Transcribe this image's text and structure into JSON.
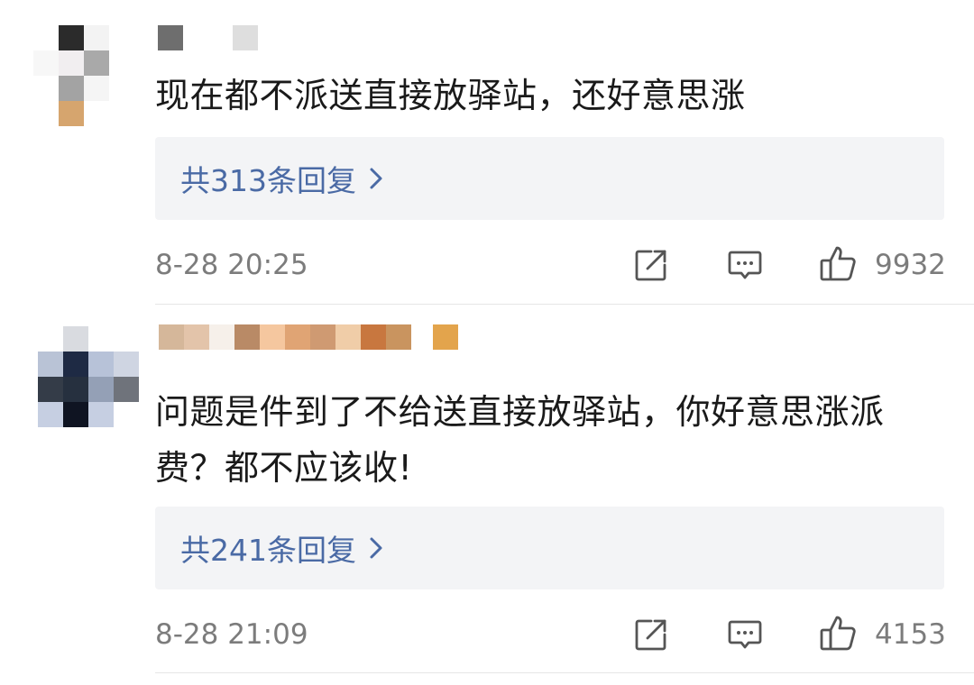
{
  "comments": [
    {
      "text": "现在都不派送直接放驿站，还好意思涨",
      "replies_label": "共313条回复",
      "time": "8-28 20:25",
      "likes": "9932"
    },
    {
      "text": "问题是件到了不给送直接放驿站，你好意思涨派费？都不应该收!",
      "replies_label": "共241条回复",
      "time": "8-28 21:09",
      "likes": "4153"
    }
  ],
  "icons": {
    "share": "share-icon",
    "comment": "comment-icon",
    "like": "thumbs-up-icon",
    "chevron": "chevron-right-icon"
  },
  "colors": {
    "reply_link": "#4a6aa5",
    "reply_bg": "#f3f4f6",
    "meta_text": "#7c7c7c"
  }
}
